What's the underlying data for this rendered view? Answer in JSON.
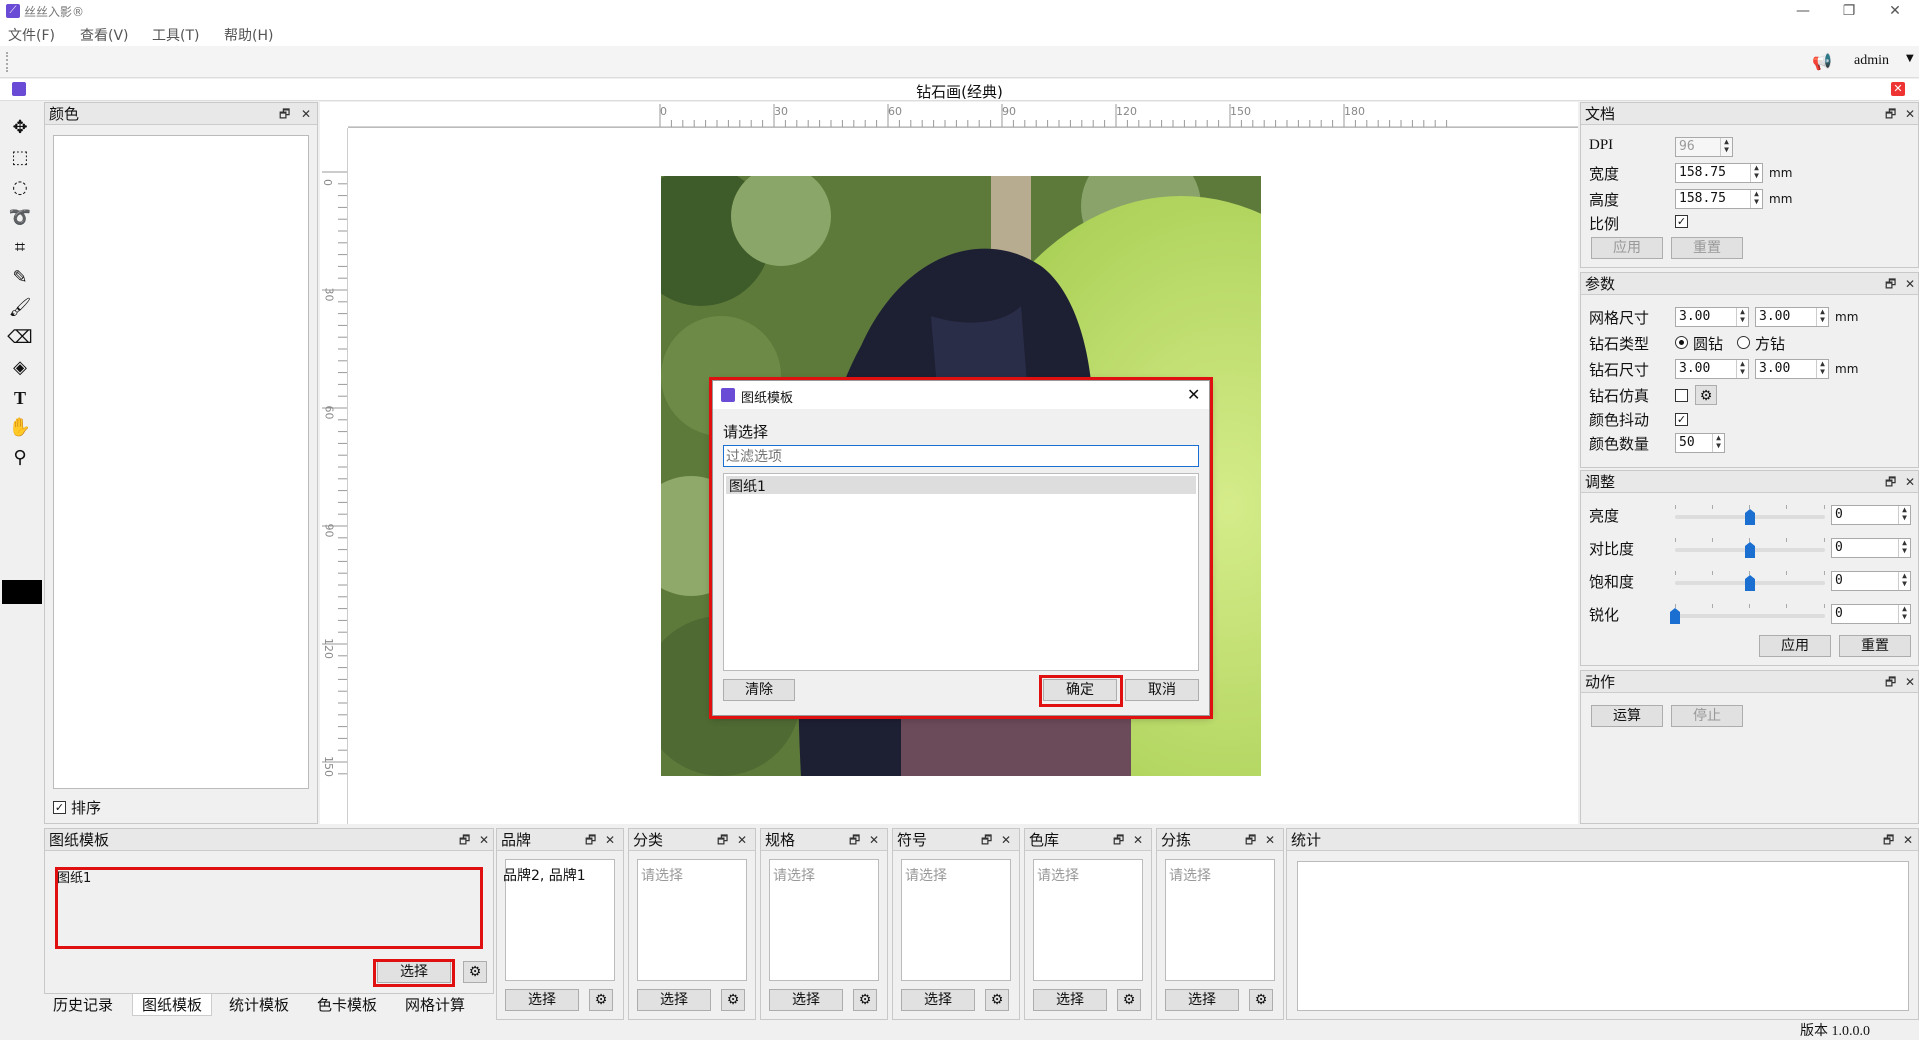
{
  "app": {
    "title": "丝丝入影®",
    "menus": [
      "文件(F)",
      "查看(V)",
      "工具(T)",
      "帮助(H)"
    ],
    "user": "admin",
    "version": "版本 1.0.0.0"
  },
  "document_tab": {
    "title": "钻石画(经典)"
  },
  "colors_panel": {
    "title": "颜色",
    "sort_label": "排序",
    "sort_checked": true
  },
  "ruler": {
    "h_ticks": [
      "0",
      "30",
      "60",
      "90",
      "120",
      "150",
      "180"
    ],
    "v_ticks": [
      "0",
      "30",
      "60",
      "90",
      "120",
      "150"
    ]
  },
  "doc_panel": {
    "title": "文档",
    "dpi_label": "DPI",
    "dpi": "96",
    "width_label": "宽度",
    "width": "158.75",
    "height_label": "高度",
    "height": "158.75",
    "unit": "mm",
    "ratio_label": "比例",
    "apply": "应用",
    "reset": "重置"
  },
  "params_panel": {
    "title": "参数",
    "grid_label": "网格尺寸",
    "grid_w": "3.00",
    "grid_h": "3.00",
    "type_label": "钻石类型",
    "round": "圆钻",
    "square": "方钻",
    "size_label": "钻石尺寸",
    "size_w": "3.00",
    "size_h": "3.00",
    "sim_label": "钻石仿真",
    "jitter_label": "颜色抖动",
    "count_label": "颜色数量",
    "count": "50",
    "unit": "mm"
  },
  "adjust_panel": {
    "title": "调整",
    "rows": [
      {
        "label": "亮度",
        "value": "0",
        "level": 0.5
      },
      {
        "label": "对比度",
        "value": "0",
        "level": 0.5
      },
      {
        "label": "饱和度",
        "value": "0",
        "level": 0.5
      },
      {
        "label": "锐化",
        "value": "0",
        "level": 0.0
      }
    ],
    "apply": "应用",
    "reset": "重置"
  },
  "action_panel": {
    "title": "动作",
    "run": "运算",
    "stop": "停止"
  },
  "bottom_panels": [
    {
      "title": "图纸模板",
      "content": "图纸1",
      "button": "选择"
    },
    {
      "title": "品牌",
      "content": "品牌2, 品牌1",
      "button": "选择"
    },
    {
      "title": "分类",
      "placeholder": "请选择",
      "button": "选择"
    },
    {
      "title": "规格",
      "placeholder": "请选择",
      "button": "选择"
    },
    {
      "title": "符号",
      "placeholder": "请选择",
      "button": "选择"
    },
    {
      "title": "色库",
      "placeholder": "请选择",
      "button": "选择"
    },
    {
      "title": "分拣",
      "placeholder": "请选择",
      "button": "选择"
    },
    {
      "title": "统计"
    }
  ],
  "bottom_tabs": [
    "历史记录",
    "图纸模板",
    "统计模板",
    "色卡模板",
    "网格计算"
  ],
  "dialog": {
    "title": "图纸模板",
    "prompt": "请选择",
    "filter_placeholder": "过滤选项",
    "items": [
      "图纸1"
    ],
    "clear": "清除",
    "ok": "确定",
    "cancel": "取消"
  },
  "colors": {
    "accent": "#1b6fd1",
    "highlight": "#e01010"
  }
}
